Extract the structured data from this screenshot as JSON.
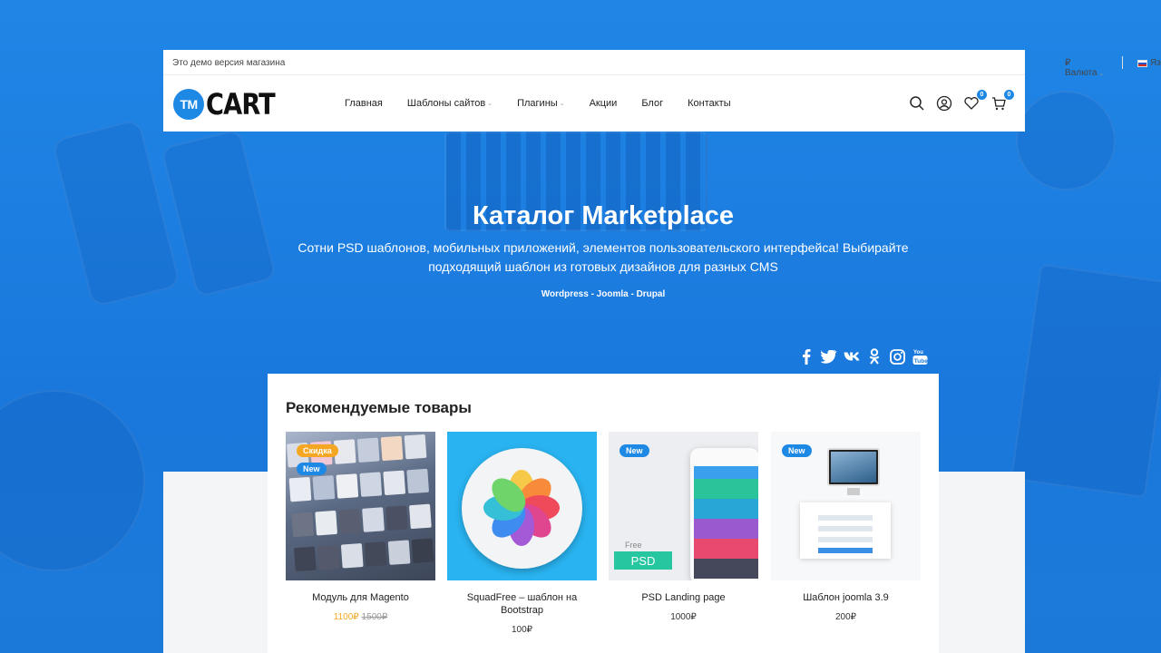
{
  "topbar": {
    "demo_text": "Это демо версия магазина",
    "currency_label": "₽ Валюта",
    "language_label": "Язык"
  },
  "header": {
    "logo_badge": "TM",
    "logo_text": "CART",
    "nav": [
      {
        "label": "Главная",
        "has_dropdown": false
      },
      {
        "label": "Шаблоны сайтов",
        "has_dropdown": true
      },
      {
        "label": "Плагины",
        "has_dropdown": true
      },
      {
        "label": "Акции",
        "has_dropdown": false
      },
      {
        "label": "Блог",
        "has_dropdown": false
      },
      {
        "label": "Контакты",
        "has_dropdown": false
      }
    ],
    "icons": [
      "search-icon",
      "user-icon",
      "heart-icon",
      "cart-icon"
    ],
    "wishlist_count": "0",
    "cart_count": "0"
  },
  "hero": {
    "title": "Каталог Marketplace",
    "subtitle": "Сотни PSD шаблонов, мобильных приложений, элементов пользовательского интерфейса! Выбирайте подходящий шаблон из готовых дизайнов для разных CMS",
    "cms": "Wordpress - Joomla - Drupal",
    "social": [
      "facebook-icon",
      "twitter-icon",
      "vk-icon",
      "odnoklassniki-icon",
      "instagram-icon",
      "youtube-icon"
    ]
  },
  "featured": {
    "title": "Рекомендуемые товары",
    "products": [
      {
        "name": "Модуль для Magento",
        "price": "1100₽",
        "old_price": "1500₽",
        "badges": [
          "Скидка",
          "New"
        ]
      },
      {
        "name": "SquadFree – шаблон на Bootstrap",
        "price": "100₽",
        "old_price": "",
        "badges": []
      },
      {
        "name": "PSD Landing page",
        "price": "1000₽",
        "old_price": "",
        "badges": [
          "New"
        ],
        "image_text": [
          "Free",
          "PSD"
        ]
      },
      {
        "name": "Шаблон joomla 3.9",
        "price": "200₽",
        "old_price": "",
        "badges": [
          "New"
        ]
      }
    ]
  },
  "colors": {
    "brand_blue": "#1e88e5",
    "sale_orange": "#f5a623",
    "background_blue": "#1c7ee0"
  }
}
